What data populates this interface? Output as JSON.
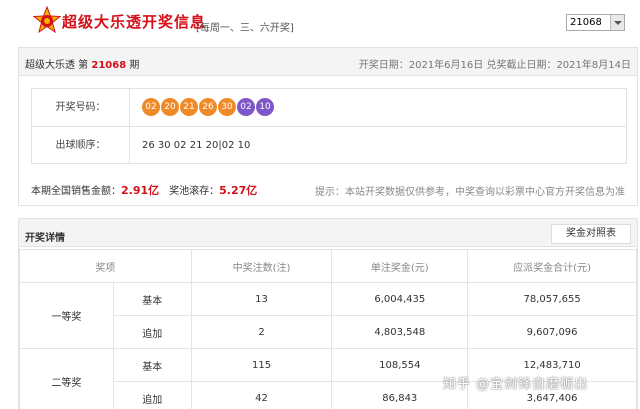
{
  "header": {
    "title": "超级大乐透开奖信息",
    "schedule": "[每周一、三、六开奖]",
    "issue_select": "21068"
  },
  "summary": {
    "title_prefix": "超级大乐透 第",
    "issue": "21068",
    "title_suffix": "期",
    "dates": "开奖日期：2021年6月16日 兑奖截止日期：2021年8月14日",
    "numbers_label": "开奖号码：",
    "red_balls": [
      "02",
      "20",
      "21",
      "26",
      "30"
    ],
    "blue_balls": [
      "02",
      "10"
    ],
    "order_label": "出球顺序：",
    "order_value": "26 30 02 21 20|02 10",
    "sales_label": "本期全国销售金额：",
    "sales_value": "2.91亿",
    "pool_label": "奖池滚存：",
    "pool_value": "5.27亿",
    "tip": "提示：本站开奖数据仅供参考，中奖查询以彩票中心官方开奖信息为准"
  },
  "detail": {
    "title": "开奖详情",
    "compare_button": "奖金对照表",
    "headers": [
      "奖项",
      "中奖注数(注)",
      "单注奖金(元)",
      "应派奖金合计(元)"
    ],
    "groups": [
      {
        "name": "一等奖",
        "rows": [
          {
            "type": "基本",
            "count": "13",
            "prize": "6,004,435",
            "total": "78,057,655"
          },
          {
            "type": "追加",
            "count": "2",
            "prize": "4,803,548",
            "total": "9,607,096"
          }
        ]
      },
      {
        "name": "二等奖",
        "rows": [
          {
            "type": "基本",
            "count": "115",
            "prize": "108,554",
            "total": "12,483,710"
          },
          {
            "type": "追加",
            "count": "42",
            "prize": "86,843",
            "total": "3,647,406"
          }
        ]
      }
    ]
  },
  "watermark": "知乎 @宝剑锋自磨砺出",
  "colors": {
    "brand_red": "#d4101a",
    "red_ball": "#f08a28",
    "blue_ball": "#7d56c8"
  }
}
